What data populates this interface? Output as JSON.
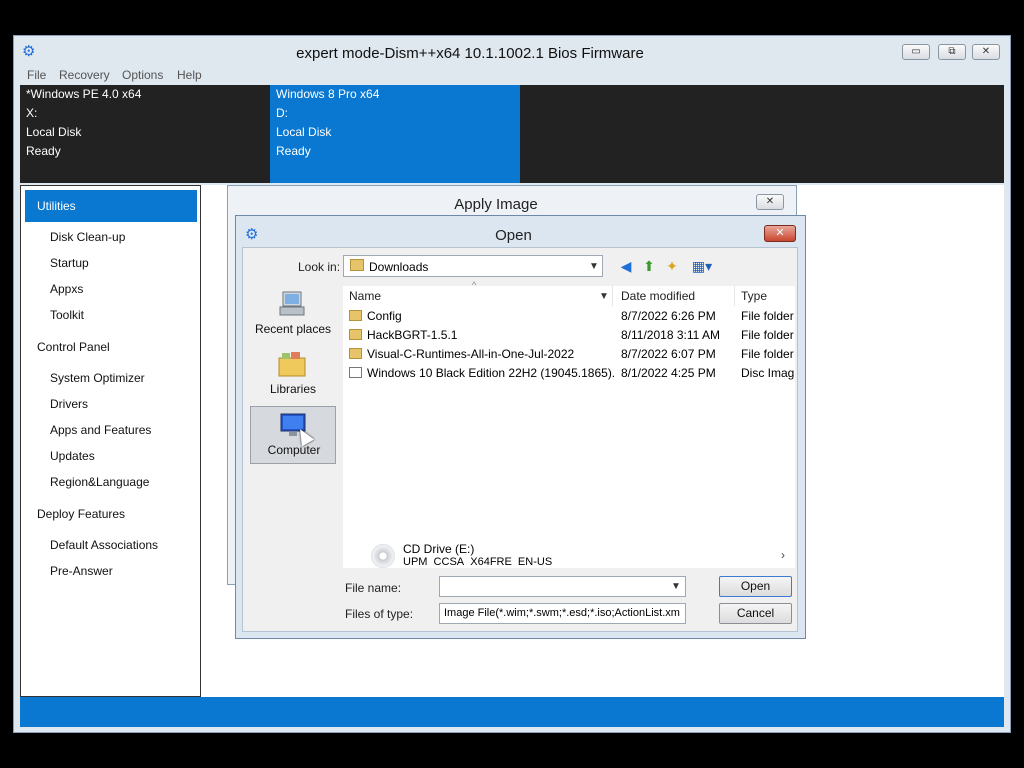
{
  "window": {
    "title": "expert mode-Dism++x64 10.1.1002.1 Bios Firmware",
    "minimize_glyph": "▭",
    "maximize_glyph": "⧉",
    "close_glyph": "✕"
  },
  "menu": [
    "File",
    "Recovery",
    "Options",
    "Help"
  ],
  "images": [
    {
      "name": "*Windows PE 4.0 x64",
      "drive": "X:",
      "disk": "Local Disk",
      "status": "Ready"
    },
    {
      "name": "Windows 8 Pro x64",
      "drive": "D:",
      "disk": "Local Disk",
      "status": "Ready"
    }
  ],
  "sidebar": {
    "items": [
      {
        "label": "Utilities",
        "kind": "cat",
        "active": true
      },
      {
        "label": "Disk Clean-up",
        "kind": "sub"
      },
      {
        "label": "Startup",
        "kind": "sub"
      },
      {
        "label": "Appxs",
        "kind": "sub"
      },
      {
        "label": "Toolkit",
        "kind": "sub"
      },
      {
        "label": "Control Panel",
        "kind": "cat"
      },
      {
        "label": "System Optimizer",
        "kind": "sub"
      },
      {
        "label": "Drivers",
        "kind": "sub"
      },
      {
        "label": "Apps and Features",
        "kind": "sub"
      },
      {
        "label": "Updates",
        "kind": "sub"
      },
      {
        "label": "Region&Language",
        "kind": "sub"
      },
      {
        "label": "Deploy Features",
        "kind": "cat"
      },
      {
        "label": "Default Associations",
        "kind": "sub"
      },
      {
        "label": "Pre-Answer",
        "kind": "sub"
      }
    ]
  },
  "apply_dialog": {
    "title": "Apply Image",
    "close_glyph": "✕"
  },
  "open_dialog": {
    "title": "Open",
    "close_glyph": "✕",
    "look_in_label": "Look in:",
    "look_in_value": "Downloads",
    "places": [
      {
        "label": "Recent places",
        "icon": "recent-places-icon"
      },
      {
        "label": "Libraries",
        "icon": "libraries-icon"
      },
      {
        "label": "Computer",
        "icon": "computer-icon",
        "selected": true
      }
    ],
    "columns": [
      "Name",
      "Date modified",
      "Type"
    ],
    "files": [
      {
        "name": "Config",
        "date": "8/7/2022 6:26 PM",
        "type": "File folder",
        "icon": "folder-icon"
      },
      {
        "name": "HackBGRT-1.5.1",
        "date": "8/11/2018 3:11 AM",
        "type": "File folder",
        "icon": "folder-icon"
      },
      {
        "name": "Visual-C-Runtimes-All-in-One-Jul-2022",
        "date": "8/7/2022 6:07 PM",
        "type": "File folder",
        "icon": "folder-icon"
      },
      {
        "name": "Windows 10 Black Edition 22H2 (19045.1865)...",
        "date": "8/1/2022 4:25 PM",
        "type": "Disc Imag",
        "icon": "disc-image-icon"
      }
    ],
    "cd_drive": {
      "label": "CD Drive (E:)",
      "sublabel": "UPM_CCSA_X64FRE_EN-US"
    },
    "file_name_label": "File name:",
    "file_name_value": "",
    "files_of_type_label": "Files of type:",
    "files_of_type_value": "Image File(*.wim;*.swm;*.esd;*.iso;ActionList.xm",
    "open_button": "Open",
    "cancel_button": "Cancel"
  }
}
